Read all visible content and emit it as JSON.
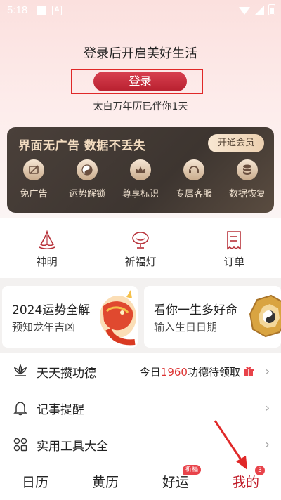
{
  "status_bar": {
    "time": "5:18",
    "app_icon": "A"
  },
  "login": {
    "title": "登录后开启美好生活",
    "button_label": "登录",
    "subtitle": "太白万年历已伴你1天"
  },
  "vip": {
    "title": "界面无广告  数据不丢失",
    "open_label": "开通会员",
    "items": [
      {
        "label": "免广告",
        "icon": "no-ads-icon"
      },
      {
        "label": "运势解锁",
        "icon": "yin-yang-icon"
      },
      {
        "label": "尊享标识",
        "icon": "crown-icon"
      },
      {
        "label": "专属客服",
        "icon": "headset-icon"
      },
      {
        "label": "数据恢复",
        "icon": "database-icon"
      }
    ]
  },
  "shortcuts": [
    {
      "label": "神明",
      "icon": "deity-icon"
    },
    {
      "label": "祈福灯",
      "icon": "lamp-icon"
    },
    {
      "label": "订单",
      "icon": "order-icon"
    }
  ],
  "promos": [
    {
      "title": "2024运势全解",
      "subtitle": "预知龙年吉凶"
    },
    {
      "title": "看你一生多好命",
      "subtitle": "输入生日日期"
    }
  ],
  "list": [
    {
      "label": "天天攒功德",
      "right_prefix": "今日",
      "right_num": "1960",
      "right_suffix": "功德待领取"
    },
    {
      "label": "记事提醒"
    },
    {
      "label": "实用工具大全"
    }
  ],
  "tabs": [
    {
      "label": "日历"
    },
    {
      "label": "黄历"
    },
    {
      "label": "好运",
      "badge": "祈福"
    },
    {
      "label": "我的",
      "badge": "3"
    }
  ],
  "colors": {
    "accent": "#c01b28",
    "vip_bg": "#3f3631",
    "highlight_frame": "#e02828"
  }
}
